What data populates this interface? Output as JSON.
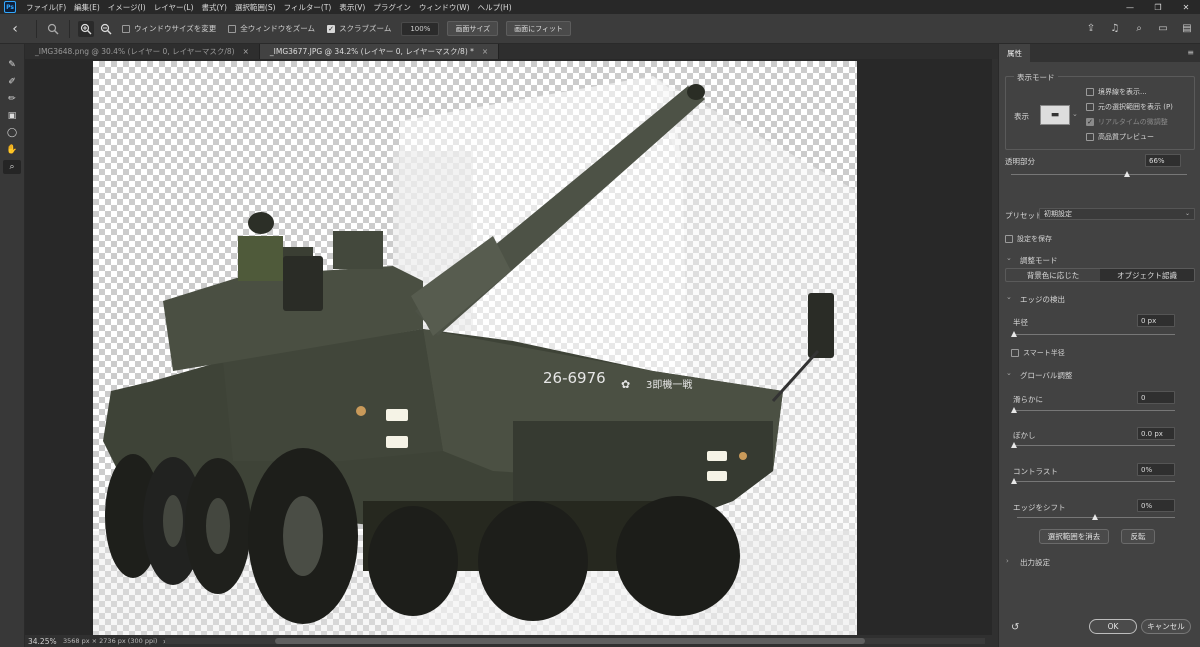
{
  "menubar": {
    "logo": "Ps",
    "items": [
      "ファイル(F)",
      "編集(E)",
      "イメージ(I)",
      "レイヤー(L)",
      "書式(Y)",
      "選択範囲(S)",
      "フィルター(T)",
      "表示(V)",
      "プラグイン",
      "ウィンドウ(W)",
      "ヘルプ(H)"
    ],
    "window_controls": [
      "—",
      "❐",
      "✕"
    ]
  },
  "optionsbar": {
    "resize_windows": "ウィンドウサイズを変更",
    "zoom_all_windows": "全ウィンドウをズーム",
    "scrubby_zoom": "スクラブズーム",
    "zoom_value": "100%",
    "fit_screen_btn": "画面サイズ",
    "fill_screen_btn": "画面にフィット"
  },
  "tabs": [
    {
      "label": "_IMG3648.png @ 30.4% (レイヤー 0, レイヤーマスク/8)",
      "close": "×"
    },
    {
      "label": "_IMG3677.JPG @ 34.2% (レイヤー 0, レイヤーマスク/8) *",
      "close": "×"
    }
  ],
  "image_text": {
    "plate": "26-6976",
    "unit": "3即機一戦"
  },
  "statusbar": {
    "zoom": "34.25%",
    "info": "3568 px × 2736 px (300 ppi)",
    "arrow": "›"
  },
  "properties": {
    "tab_label": "属性",
    "view_mode_title": "表示モード",
    "view_label": "表示",
    "show_edge": "境界線を表示...",
    "show_original": "元の選択範囲を表示 (P)",
    "realtime_refine": "リアルタイムの微調整",
    "hq_preview": "高品質プレビュー",
    "opacity_label": "透明部分",
    "opacity_value": "66%",
    "opacity_level": 0.66,
    "preset_label": "プリセット",
    "preset_value": "初期設定",
    "remember_settings": "設定を保存",
    "refine_mode_title": "調整モード",
    "refine_mode_color": "背景色に応じた",
    "refine_mode_object": "オブジェクト認識",
    "edge_detection_title": "エッジの検出",
    "radius_label": "半径",
    "radius_value": "0 px",
    "smart_radius": "スマート半径",
    "global_title": "グローバル調整",
    "smooth_label": "滑らかに",
    "smooth_value": "0",
    "feather_label": "ぼかし",
    "feather_value": "0.0 px",
    "contrast_label": "コントラスト",
    "contrast_value": "0%",
    "shift_edge_label": "エッジをシフト",
    "shift_edge_value": "0%",
    "clear_selection_btn": "選択範囲を消去",
    "invert_btn": "反転",
    "output_title": "出力設定",
    "ok_btn": "OK",
    "cancel_btn": "キャンセル"
  }
}
